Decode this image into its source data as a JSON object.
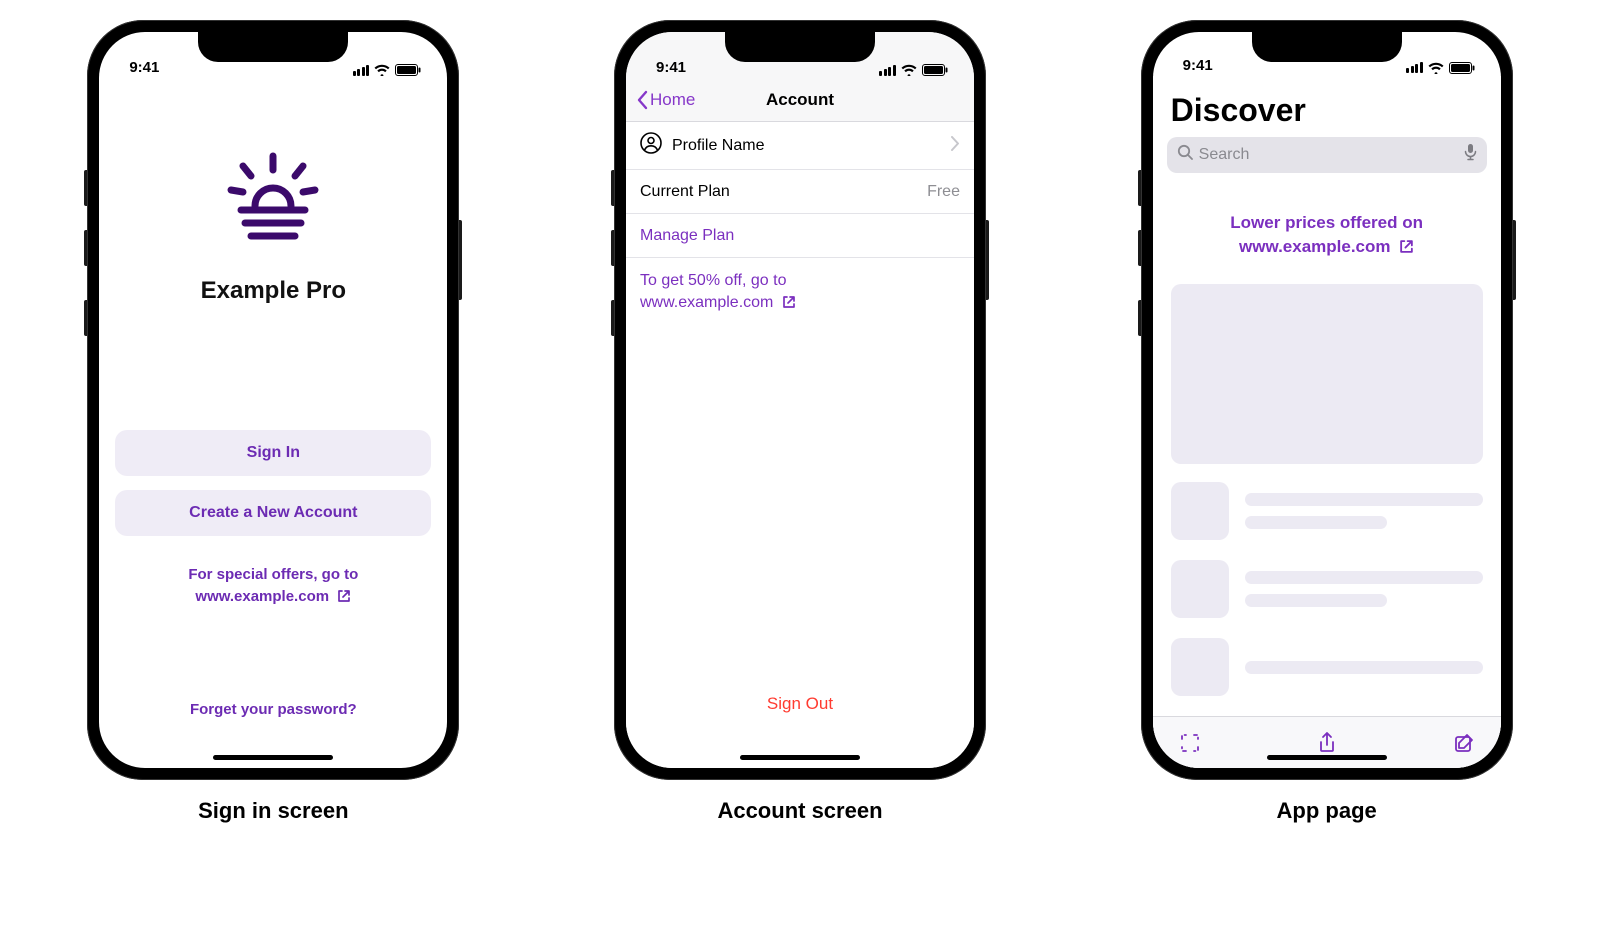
{
  "status": {
    "time": "9:41"
  },
  "captions": {
    "signin": "Sign in screen",
    "account": "Account screen",
    "discover": "App page"
  },
  "signin": {
    "appName": "Example Pro",
    "signInLabel": "Sign In",
    "createLabel": "Create a New Account",
    "offersLine1": "For special offers, go to",
    "offersLine2": "www.example.com",
    "forgot": "Forget your password?"
  },
  "account": {
    "backLabel": "Home",
    "title": "Account",
    "profileName": "Profile Name",
    "currentPlanLabel": "Current Plan",
    "currentPlanValue": "Free",
    "managePlan": "Manage Plan",
    "promoLine1": "To get 50% off, go to",
    "promoLine2": "www.example.com",
    "signOut": "Sign Out"
  },
  "discover": {
    "title": "Discover",
    "searchPlaceholder": "Search",
    "promoLine1": "Lower prices offered on",
    "promoLine2": "www.example.com"
  }
}
